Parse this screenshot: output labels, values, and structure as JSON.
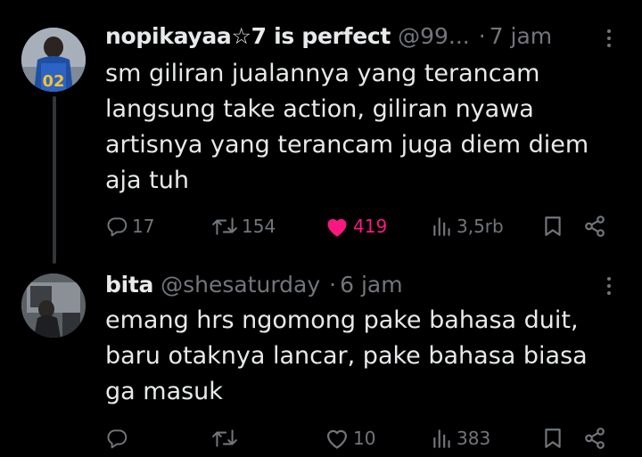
{
  "tweets": [
    {
      "display_name": "nopikayaa☆7 is perfect",
      "handle": "@99...",
      "separator": "·",
      "time": "7 jam",
      "text": "sm giliran jualannya yang terancam langsung take action, giliran nyawa artisnya yang terancam juga diem diem aja tuh",
      "avatar_jersey": "02",
      "stats": {
        "replies": "17",
        "retweets": "154",
        "likes": "419",
        "views": "3,5rb"
      },
      "liked": true
    },
    {
      "display_name": "bita",
      "handle": "@shesaturday",
      "separator": "·",
      "time": "6 jam",
      "text": "emang hrs ngomong pake bahasa duit, baru otaknya lancar, pake bahasa biasa ga masuk",
      "stats": {
        "replies": "",
        "retweets": "",
        "likes": "10",
        "views": "383"
      },
      "liked": false
    }
  ],
  "colors": {
    "like_active": "#f91880",
    "muted": "#71767b",
    "text": "#e7e9ea",
    "thread_line": "#333639"
  },
  "icons": [
    "reply-icon",
    "retweet-icon",
    "heart-icon",
    "views-icon",
    "bookmark-icon",
    "share-icon",
    "more-icon"
  ]
}
